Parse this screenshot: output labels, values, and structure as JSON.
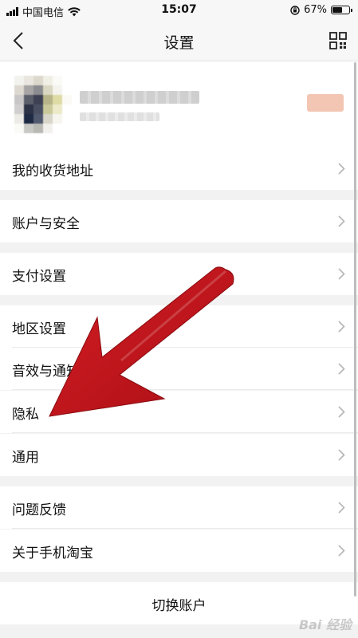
{
  "status_bar": {
    "carrier": "中国电信",
    "time": "15:07",
    "battery": "67%",
    "battery_level": 0.67
  },
  "nav": {
    "title": "设置"
  },
  "menu": [
    {
      "label": "我的收货地址"
    },
    {
      "label": "账户与安全"
    },
    {
      "label": "支付设置"
    },
    {
      "label": "地区设置"
    },
    {
      "label": "音效与通知"
    },
    {
      "label": "隐私"
    },
    {
      "label": "通用"
    },
    {
      "label": "问题反馈"
    },
    {
      "label": "关于手机淘宝"
    }
  ],
  "switch_account": "切换账户",
  "watermark": "Bai 经验",
  "colors": {
    "annotation_arrow": "#c8131b",
    "background": "#f2f2f2"
  }
}
